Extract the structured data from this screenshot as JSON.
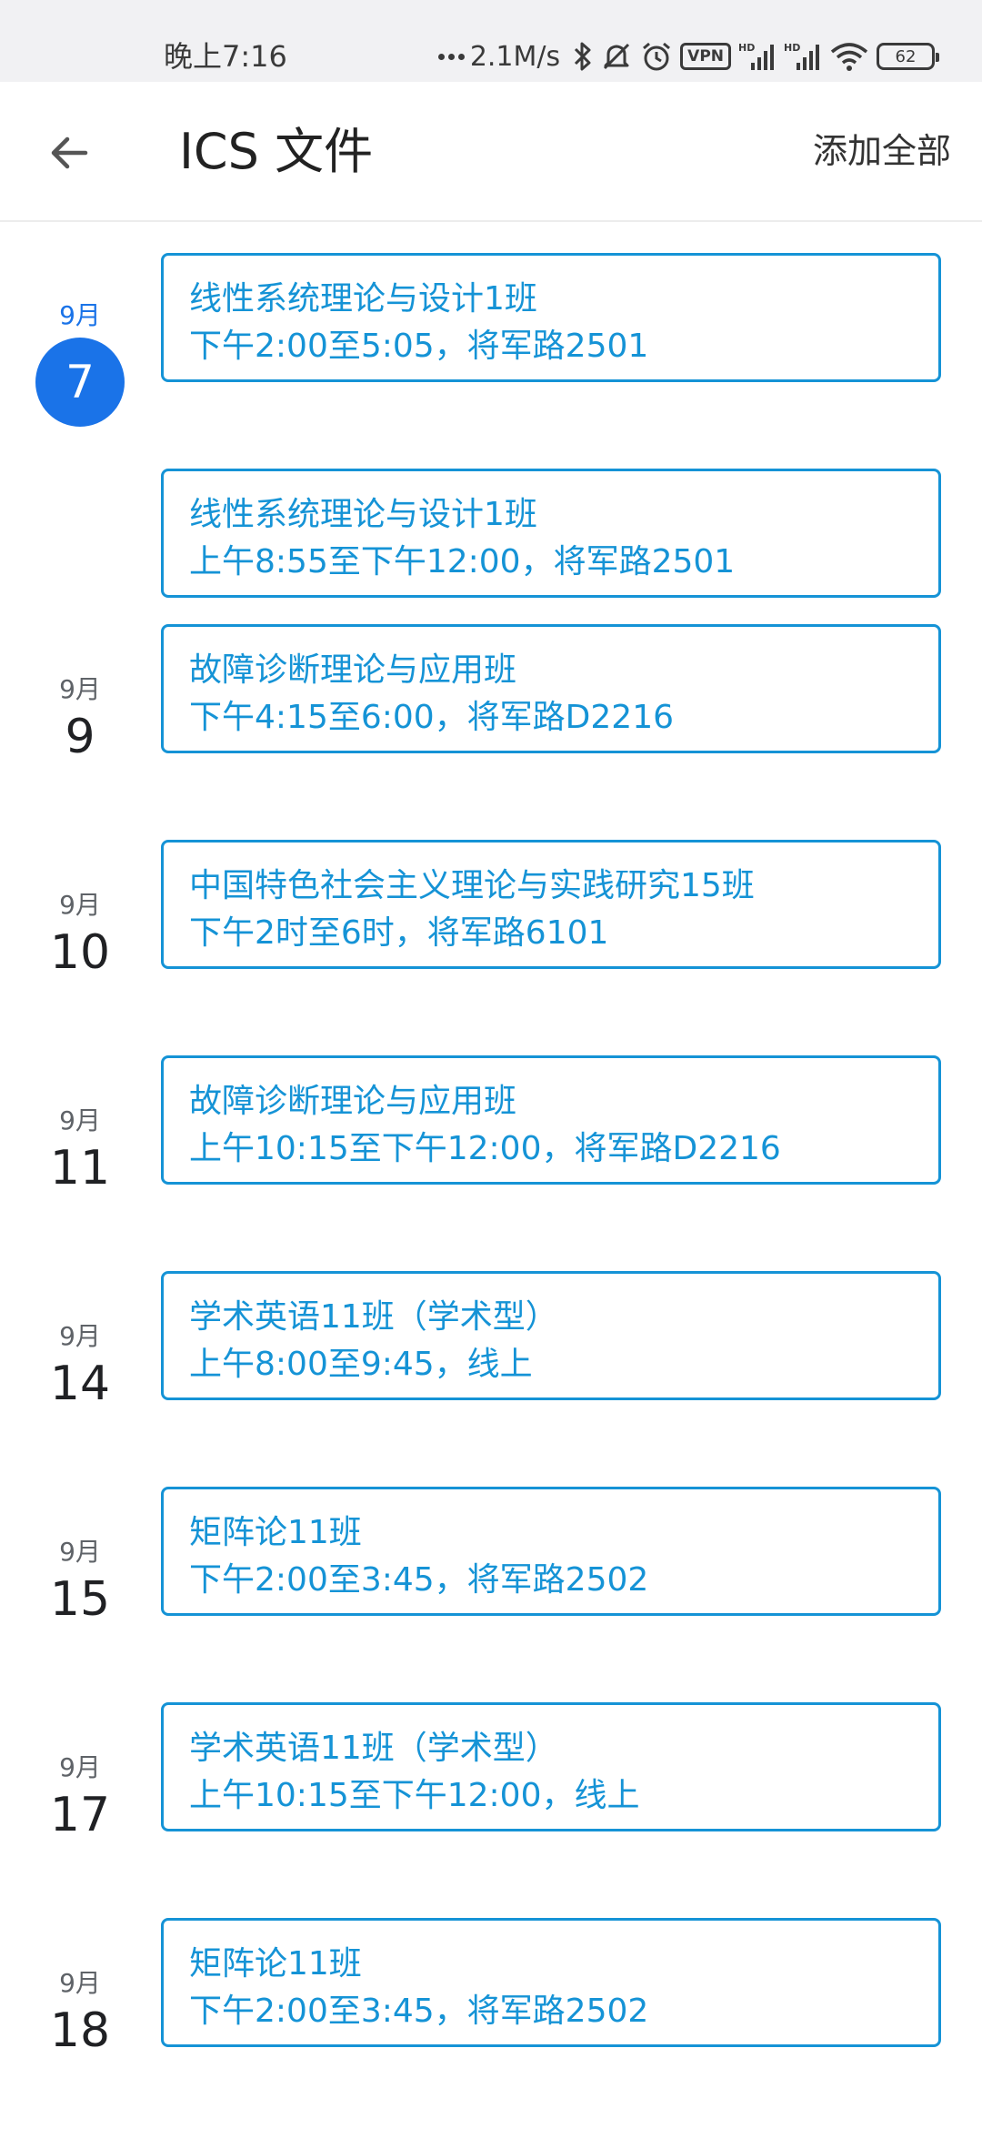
{
  "status_bar": {
    "time": "晚上7:16",
    "net_speed": "2.1M/s",
    "vpn_label": "VPN",
    "battery": "62",
    "icons": [
      "dots-icon",
      "bluetooth-icon",
      "mute-icon",
      "alarm-icon",
      "vpn-icon",
      "signal-hd-icon",
      "signal-hd-icon",
      "wifi-icon",
      "battery-icon"
    ]
  },
  "app_bar": {
    "back_icon": "arrow-left-icon",
    "title": "ICS 文件",
    "add_all_label": "添加全部"
  },
  "colors": {
    "accent": "#1593d6",
    "today": "#1a73e8"
  },
  "dates": [
    {
      "month": "9月",
      "day": "7",
      "today": true
    },
    {
      "month": "9月",
      "day": "9"
    },
    {
      "month": "9月",
      "day": "10"
    },
    {
      "month": "9月",
      "day": "11"
    },
    {
      "month": "9月",
      "day": "14"
    },
    {
      "month": "9月",
      "day": "15"
    },
    {
      "month": "9月",
      "day": "17"
    },
    {
      "month": "9月",
      "day": "18"
    }
  ],
  "events": [
    {
      "title": "线性系统理论与设计1班",
      "detail": "下午2:00至5:05，将军路2501"
    },
    {
      "title": "线性系统理论与设计1班",
      "detail": "上午8:55至下午12:00，将军路2501"
    },
    {
      "title": "故障诊断理论与应用班",
      "detail": "下午4:15至6:00，将军路D2216"
    },
    {
      "title": "中国特色社会主义理论与实践研究15班",
      "detail": "下午2时至6时，将军路6101"
    },
    {
      "title": "故障诊断理论与应用班",
      "detail": "上午10:15至下午12:00，将军路D2216"
    },
    {
      "title": "学术英语11班（学术型）",
      "detail": "上午8:00至9:45，线上"
    },
    {
      "title": "矩阵论11班",
      "detail": "下午2:00至3:45，将军路2502"
    },
    {
      "title": "学术英语11班（学术型）",
      "detail": "上午10:15至下午12:00，线上"
    },
    {
      "title": "矩阵论11班",
      "detail": "下午2:00至3:45，将军路2502"
    }
  ]
}
